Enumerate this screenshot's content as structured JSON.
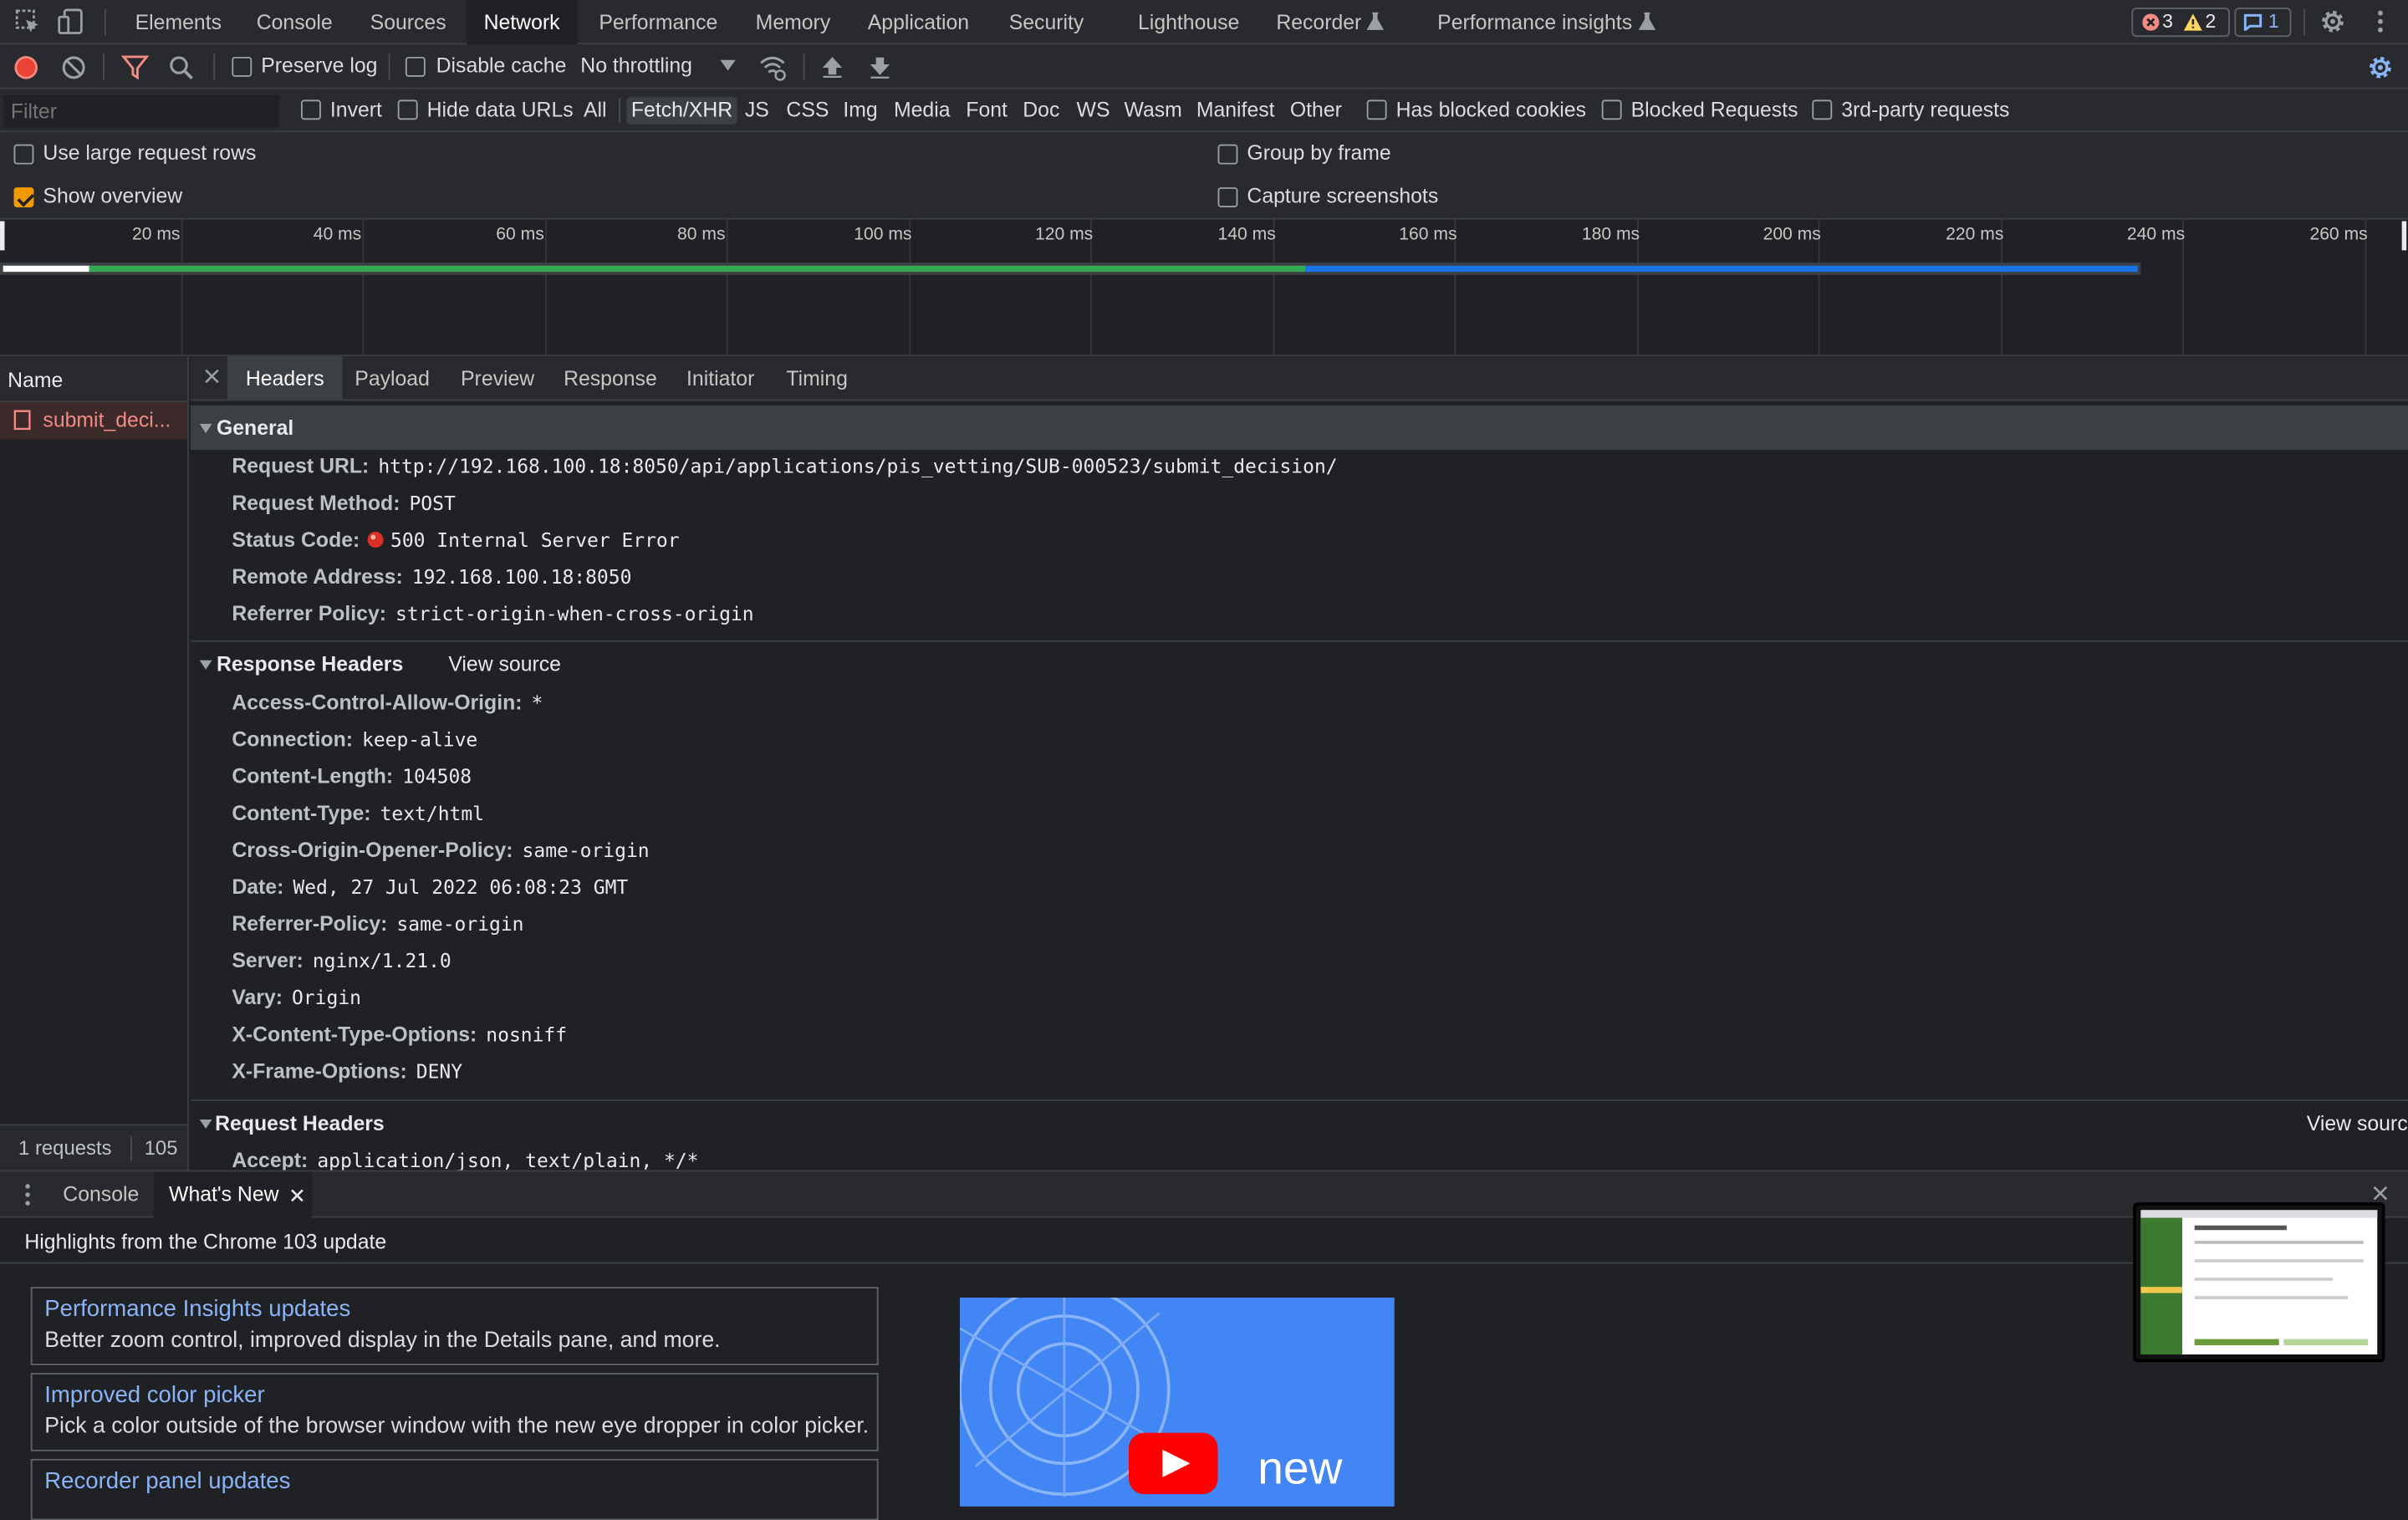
{
  "main_tabs": [
    "Elements",
    "Console",
    "Sources",
    "Network",
    "Performance",
    "Memory",
    "Application",
    "Security",
    "Lighthouse",
    "Recorder",
    "Performance insights"
  ],
  "badges": {
    "errors": "3",
    "warnings": "2",
    "messages": "1"
  },
  "toolbar": {
    "preserve_log": "Preserve log",
    "disable_cache": "Disable cache",
    "throttling": "No throttling"
  },
  "filter": {
    "placeholder": "Filter",
    "invert": "Invert",
    "hide_data_urls": "Hide data URLs",
    "types": [
      "All",
      "Fetch/XHR",
      "JS",
      "CSS",
      "Img",
      "Media",
      "Font",
      "Doc",
      "WS",
      "Wasm",
      "Manifest",
      "Other"
    ],
    "active_type": "Fetch/XHR",
    "has_blocked_cookies": "Has blocked cookies",
    "blocked_requests": "Blocked Requests",
    "third_party": "3rd-party requests"
  },
  "settings": {
    "large_rows": "Use large request rows",
    "show_overview": "Show overview",
    "group_by_frame": "Group by frame",
    "capture_screenshots": "Capture screenshots"
  },
  "overview": {
    "ticks": [
      "20 ms",
      "40 ms",
      "60 ms",
      "80 ms",
      "100 ms",
      "120 ms",
      "140 ms",
      "160 ms",
      "180 ms",
      "200 ms",
      "220 ms",
      "240 ms",
      "260 ms"
    ],
    "colors": {
      "waiting": "#34a853",
      "download": "#1a73e8"
    }
  },
  "name_column": {
    "header": "Name",
    "request_name": "submit_deci...",
    "footer_count": "1 requests",
    "footer_size": "105"
  },
  "detail_tabs": [
    "Headers",
    "Payload",
    "Preview",
    "Response",
    "Initiator",
    "Timing"
  ],
  "general": {
    "title": "General",
    "rows": [
      {
        "key": "Request URL:",
        "value": "http://192.168.100.18:8050/api/applications/pis_vetting/SUB-000523/submit_decision/"
      },
      {
        "key": "Request Method:",
        "value": "POST"
      },
      {
        "key": "Status Code:",
        "value": "500 Internal Server Error"
      },
      {
        "key": "Remote Address:",
        "value": "192.168.100.18:8050"
      },
      {
        "key": "Referrer Policy:",
        "value": "strict-origin-when-cross-origin"
      }
    ]
  },
  "response_headers": {
    "title": "Response Headers",
    "view_source": "View source",
    "rows": [
      {
        "key": "Access-Control-Allow-Origin:",
        "value": "*"
      },
      {
        "key": "Connection:",
        "value": "keep-alive"
      },
      {
        "key": "Content-Length:",
        "value": "104508"
      },
      {
        "key": "Content-Type:",
        "value": "text/html"
      },
      {
        "key": "Cross-Origin-Opener-Policy:",
        "value": "same-origin"
      },
      {
        "key": "Date:",
        "value": "Wed, 27 Jul 2022 06:08:23 GMT"
      },
      {
        "key": "Referrer-Policy:",
        "value": "same-origin"
      },
      {
        "key": "Server:",
        "value": "nginx/1.21.0"
      },
      {
        "key": "Vary:",
        "value": "Origin"
      },
      {
        "key": "X-Content-Type-Options:",
        "value": "nosniff"
      },
      {
        "key": "X-Frame-Options:",
        "value": "DENY"
      }
    ]
  },
  "request_headers": {
    "title": "Request Headers",
    "view_source": "View source",
    "rows": [
      {
        "key": "Accept:",
        "value": "application/json, text/plain, */*"
      }
    ]
  },
  "drawer": {
    "tabs": [
      "Console",
      "What's New"
    ],
    "highlight": "Highlights from the Chrome 103 update",
    "cards": [
      {
        "title": "Performance Insights updates",
        "desc": "Better zoom control, improved display in the Details pane, and more."
      },
      {
        "title": "Improved color picker",
        "desc": "Pick a color outside of the browser window with the new eye dropper in color picker."
      },
      {
        "title": "Recorder panel updates",
        "desc": ""
      }
    ],
    "video_text": "new"
  }
}
